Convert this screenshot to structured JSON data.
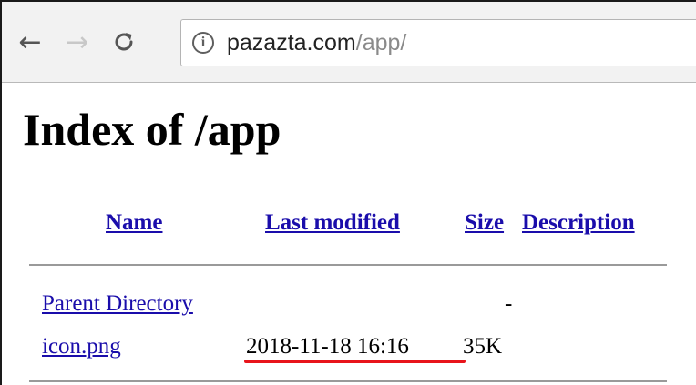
{
  "browser": {
    "back_icon": "arrow-left-icon",
    "forward_icon": "arrow-right-icon",
    "reload_icon": "reload-icon",
    "site_info_icon": "info-icon",
    "url_domain": "pazazta.com",
    "url_path": "/app/"
  },
  "page": {
    "title": "Index of /app",
    "columns": {
      "name": "Name",
      "last_modified": "Last modified",
      "size": "Size",
      "description": "Description"
    },
    "rows": [
      {
        "name": "Parent Directory",
        "last_modified": "",
        "size": "-"
      },
      {
        "name": "icon.png",
        "last_modified": "2018-11-18 16:16",
        "size": "35K"
      }
    ],
    "highlight_color": "#e8141b",
    "link_color": "#1a0dab"
  }
}
